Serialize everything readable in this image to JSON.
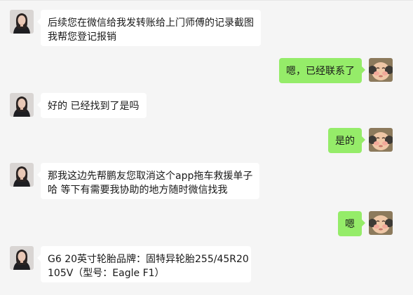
{
  "colors": {
    "background": "#f5f5f5",
    "incoming_bubble": "#ffffff",
    "outgoing_bubble": "#95ec69",
    "text": "#191919"
  },
  "messages": [
    {
      "sender": "other",
      "avatar_icon": "woman-portrait-avatar",
      "lines": [
        "后续您在微信给我发转账给上门师傅的记录截图",
        "我帮您登记报销"
      ]
    },
    {
      "sender": "self",
      "avatar_icon": "baby-face-avatar",
      "lines": [
        "嗯，已经联系了"
      ]
    },
    {
      "sender": "other",
      "avatar_icon": "woman-portrait-avatar",
      "lines": [
        "好的 已经找到了是吗"
      ]
    },
    {
      "sender": "self",
      "avatar_icon": "baby-face-avatar",
      "lines": [
        "是的"
      ]
    },
    {
      "sender": "other",
      "avatar_icon": "woman-portrait-avatar",
      "lines": [
        "那我这边先帮鹏友您取消这个app拖车救援单子",
        "哈 等下有需要我协助的地方随时微信找我"
      ]
    },
    {
      "sender": "self",
      "avatar_icon": "baby-face-avatar",
      "lines": [
        "嗯"
      ]
    },
    {
      "sender": "other",
      "avatar_icon": "woman-portrait-avatar",
      "lines": [
        "G6 20英寸轮胎品牌：固特异轮胎255/45R20",
        "105V（型号：Eagle F1）"
      ]
    }
  ]
}
